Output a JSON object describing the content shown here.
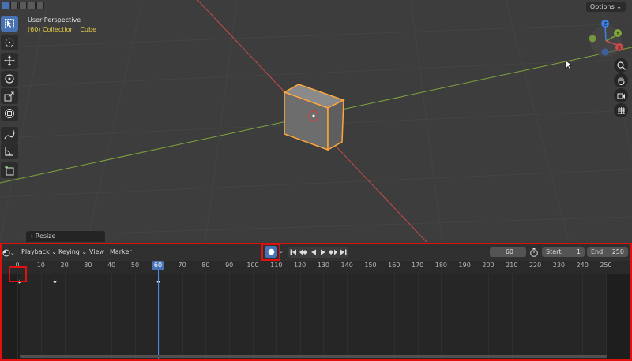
{
  "viewport": {
    "title": "User Perspective",
    "subtitle_collection": "(60) Collection",
    "subtitle_separator": "|",
    "subtitle_object": "Cube",
    "options_label": "Options",
    "axis_labels": {
      "z": "Z",
      "y": "Y",
      "x": "X"
    }
  },
  "colors": {
    "accent": "#4772b3",
    "selection_outline": "#ffa63d",
    "axis_x": "#c84b4b",
    "axis_y": "#7fa53d",
    "axis_z": "#3d7fe0",
    "highlight_box": "#e01010"
  },
  "toolbar": {
    "tools": [
      {
        "name": "select-box",
        "icon": "cursor-arrow-icon"
      },
      {
        "name": "cursor",
        "icon": "3d-cursor-icon"
      },
      {
        "name": "move",
        "icon": "move-arrows-icon"
      },
      {
        "name": "rotate",
        "icon": "rotate-icon"
      },
      {
        "name": "scale",
        "icon": "scale-icon"
      },
      {
        "name": "transform",
        "icon": "transform-icon"
      },
      {
        "name": "annotate",
        "icon": "annotate-pen-icon"
      },
      {
        "name": "measure",
        "icon": "measure-ruler-icon"
      },
      {
        "name": "add-cube",
        "icon": "add-cube-icon"
      }
    ]
  },
  "nav_tools": [
    "zoom-icon",
    "hand-pan-icon",
    "camera-icon",
    "grid-view-icon"
  ],
  "resize_panel": {
    "label": "Resize"
  },
  "timeline": {
    "menus": [
      "Playback",
      "Keying",
      "View",
      "Marker"
    ],
    "current_frame": "60",
    "start_label": "Start",
    "start_value": "1",
    "end_label": "End",
    "end_value": "250",
    "ruler_labels": [
      "0",
      "10",
      "20",
      "30",
      "40",
      "50",
      "60",
      "70",
      "80",
      "90",
      "100",
      "110",
      "120",
      "130",
      "140",
      "150",
      "160",
      "170",
      "180",
      "190",
      "200",
      "210",
      "220",
      "230",
      "240",
      "250"
    ],
    "keyframes": [
      1,
      16,
      60
    ]
  }
}
